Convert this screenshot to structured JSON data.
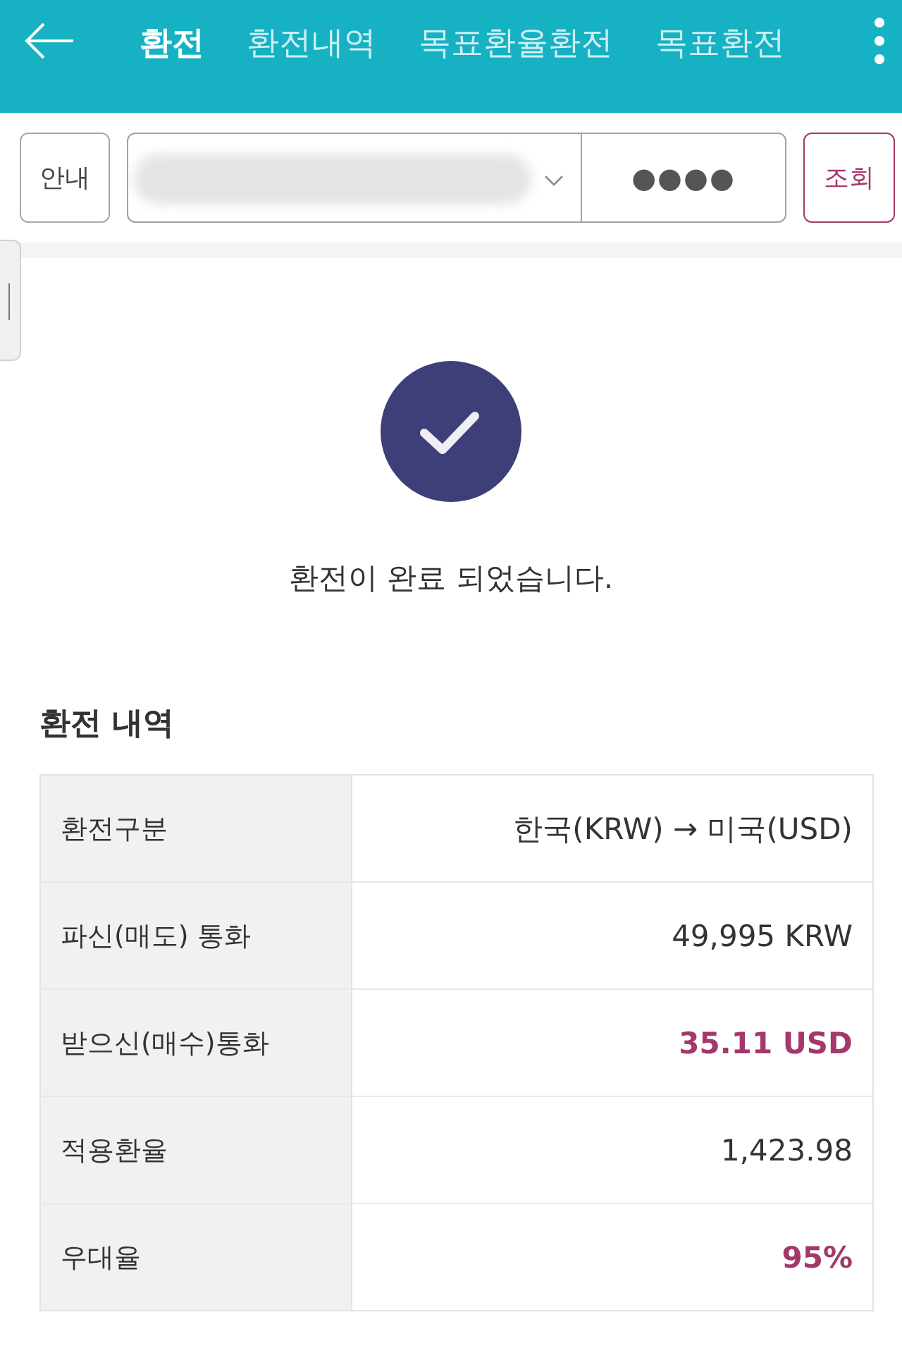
{
  "header": {
    "tabs": [
      {
        "label": "환전",
        "selected": true
      },
      {
        "label": "환전내역",
        "selected": false
      },
      {
        "label": "목표환율환전",
        "selected": false
      },
      {
        "label": "목표환전",
        "selected": false
      }
    ]
  },
  "toolbar": {
    "guide_button": "안내",
    "password": {
      "value": "●●●●"
    },
    "search_button": "조회"
  },
  "result": {
    "message": "환전이 완료 되었습니다."
  },
  "details": {
    "title": "환전 내역",
    "rows": [
      {
        "label": "환전구분",
        "value": "한국(KRW) → 미국(USD)",
        "highlighted": false
      },
      {
        "label": "파신(매도) 통화",
        "value": "49,995 KRW",
        "highlighted": false
      },
      {
        "label": "받으신(매수)통화",
        "value": "35.11 USD",
        "highlighted": true
      },
      {
        "label": "적용환율",
        "value": "1,423.98",
        "highlighted": false
      },
      {
        "label": "우대율",
        "value": "95%",
        "highlighted": true
      }
    ]
  }
}
